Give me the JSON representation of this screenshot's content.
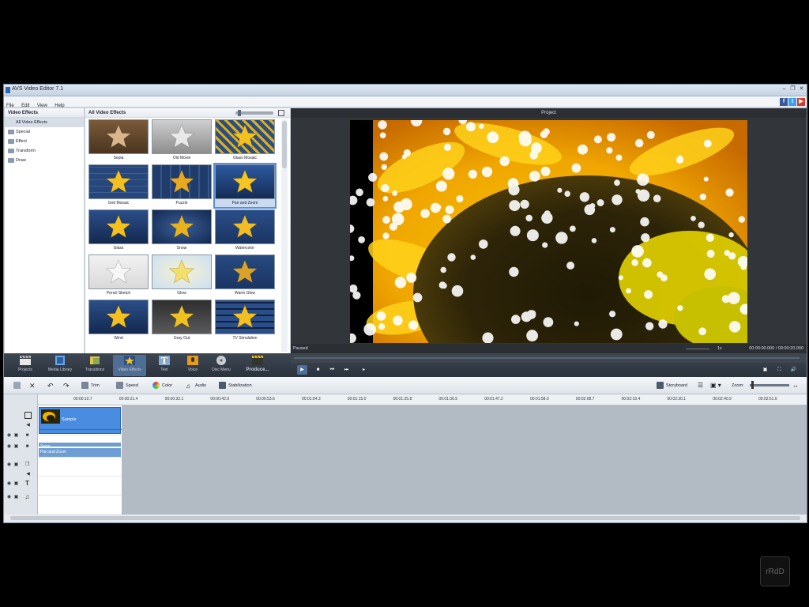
{
  "window": {
    "title": "AVS Video Editor 7.1"
  },
  "menu": [
    "File",
    "Edit",
    "View",
    "Help"
  ],
  "social_icons": [
    "facebook-icon",
    "twitter-icon",
    "youtube-icon"
  ],
  "categories": {
    "header": "Video Effects",
    "items": [
      "All Video Effects",
      "Special",
      "Effect",
      "Transform",
      "Draw"
    ],
    "selected": "All Video Effects"
  },
  "effects": {
    "header": "All Video Effects",
    "items": [
      "Sepia",
      "Old Movie",
      "Glass Mosaic",
      "Grid Mosaic",
      "Puzzle",
      "Pan and Zoom",
      "Glass",
      "Snow",
      "Watercolor",
      "Pencil Sketch",
      "Glow",
      "Warm Glow",
      "Wind",
      "Gray Out",
      "TV Simulation"
    ],
    "selected": "Pan and Zoom"
  },
  "preview": {
    "header": "Project",
    "status": "Paused",
    "speed": "1x",
    "time": "00:00:00.000 / 00:00:20.000"
  },
  "nav": [
    {
      "label": "Projects",
      "icon": "clapperboard-icon"
    },
    {
      "label": "Media Library",
      "icon": "film-icon"
    },
    {
      "label": "Transitions",
      "icon": "transition-icon"
    },
    {
      "label": "Video Effects",
      "icon": "star-icon"
    },
    {
      "label": "Text",
      "icon": "text-icon"
    },
    {
      "label": "Voice",
      "icon": "microphone-icon"
    },
    {
      "label": "Disc Menu",
      "icon": "disc-icon"
    },
    {
      "label": "Produce...",
      "icon": "produce-icon"
    }
  ],
  "nav_selected": "Video Effects",
  "edit_tools": {
    "trim": "Trim",
    "speed": "Speed",
    "color": "Color",
    "audio": "Audio",
    "stabilization": "Stabilization",
    "storyboard": "Storyboard",
    "zoom_label": "Zoom:"
  },
  "ruler_ticks": [
    "00:00:10.7",
    "00:00:21.4",
    "00:00:32.1",
    "00:00:42.9",
    "00:00:53.6",
    "00:01:04.3",
    "00:01:15.0",
    "00:01:25.8",
    "00:01:36.5",
    "00:01:47.2",
    "00:01:58.0",
    "00:02:08.7",
    "00:02:19.4",
    "00:02:30.1",
    "00:02:40.9",
    "00:02:51.6"
  ],
  "timeline": {
    "clip_label": "Sample",
    "effect_tracks": [
      "Snow",
      "Pan and Zoom"
    ]
  },
  "watermark": "rRdD"
}
